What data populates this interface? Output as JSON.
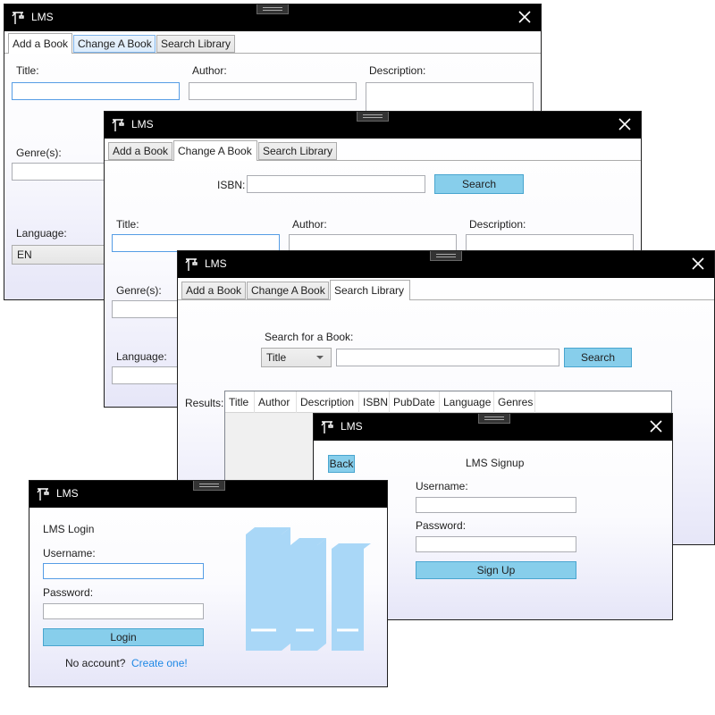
{
  "app": {
    "title": "LMS"
  },
  "add_book_window": {
    "tabs": [
      "Add a Book",
      "Change A Book",
      "Search Library"
    ],
    "active_tab": "Add a Book",
    "fields": {
      "title_label": "Title:",
      "author_label": "Author:",
      "description_label": "Description:",
      "genres_label": "Genre(s):",
      "language_label": "Language:",
      "language_value": "EN"
    }
  },
  "change_book_window": {
    "tabs": [
      "Add a Book",
      "Change A Book",
      "Search Library"
    ],
    "active_tab": "Change A Book",
    "isbn_label": "ISBN:",
    "search_button": "Search",
    "fields": {
      "title_label": "Title:",
      "author_label": "Author:",
      "description_label": "Description:",
      "genres_label": "Genre(s):",
      "language_label": "Language:"
    }
  },
  "search_window": {
    "tabs": [
      "Add a Book",
      "Change A Book",
      "Search Library"
    ],
    "active_tab": "Search Library",
    "search_label": "Search for a Book:",
    "filter_selected": "Title",
    "search_button": "Search",
    "results_label": "Results:",
    "columns": [
      "Title",
      "Author",
      "Description",
      "ISBN",
      "PubDate",
      "Language",
      "Genres"
    ]
  },
  "signup_window": {
    "back_button": "Back",
    "heading": "LMS Signup",
    "username_label": "Username:",
    "password_label": "Password:",
    "signup_button": "Sign Up"
  },
  "login_window": {
    "heading": "LMS Login",
    "username_label": "Username:",
    "password_label": "Password:",
    "login_button": "Login",
    "no_account_text": "No account?",
    "create_link": "Create one!"
  },
  "icons": {
    "app_logo": "lamp-post-icon",
    "close": "close-icon",
    "books_illustration": "books-icon"
  },
  "colors": {
    "titlebar": "#000000",
    "accent_button": "#87ceeb",
    "focus_border": "#569de5",
    "link": "#1e88e5",
    "illustration": "#a9d7f7"
  }
}
